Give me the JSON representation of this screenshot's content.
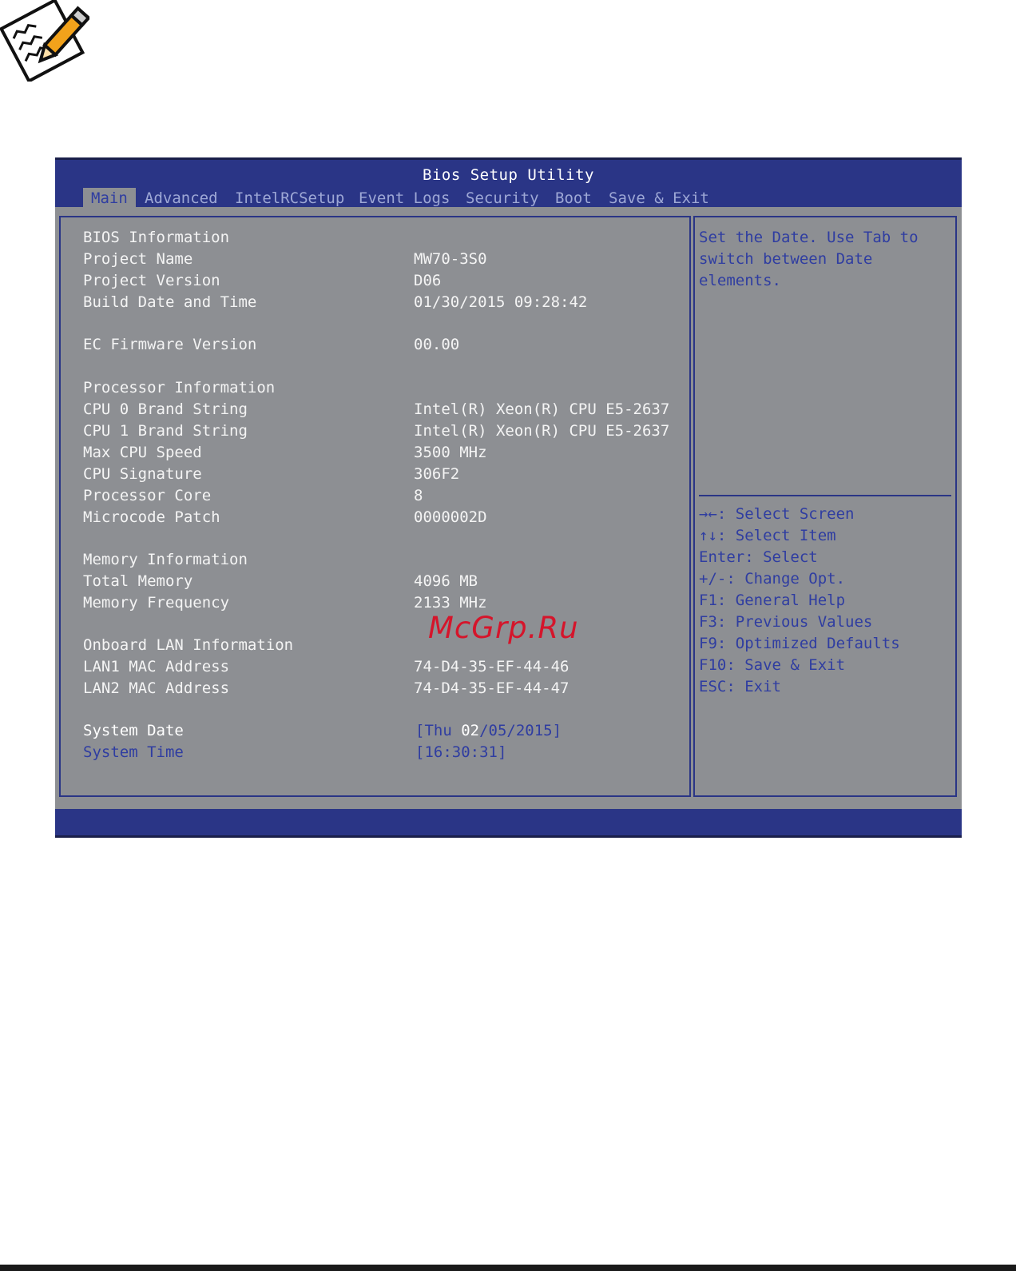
{
  "window": {
    "title": "Bios Setup Utility"
  },
  "tabs": [
    {
      "label": "Main",
      "active": true
    },
    {
      "label": "Advanced"
    },
    {
      "label": "IntelRCSetup"
    },
    {
      "label": "Event Logs"
    },
    {
      "label": "Security"
    },
    {
      "label": "Boot"
    },
    {
      "label": "Save & Exit"
    }
  ],
  "main": {
    "bios_info": "BIOS Information",
    "project_name": {
      "label": "Project Name",
      "value": "MW70-3S0"
    },
    "project_version": {
      "label": "Project Version",
      "value": "D06"
    },
    "build_date": {
      "label": "Build Date and Time",
      "value": "01/30/2015 09:28:42"
    },
    "ec_fw": {
      "label": "EC Firmware Version",
      "value": "00.00"
    },
    "proc_info": "Processor Information",
    "cpu0": {
      "label": "CPU 0 Brand String",
      "value": "Intel(R) Xeon(R) CPU E5-2637"
    },
    "cpu1": {
      "label": "CPU 1 Brand String",
      "value": "Intel(R) Xeon(R) CPU E5-2637"
    },
    "max_speed": {
      "label": "Max CPU Speed",
      "value": "3500 MHz"
    },
    "signature": {
      "label": "CPU Signature",
      "value": "306F2"
    },
    "core": {
      "label": "Processor Core",
      "value": "8"
    },
    "microcode": {
      "label": "Microcode Patch",
      "value": "0000002D"
    },
    "mem_info": "Memory Information",
    "total_mem": {
      "label": "Total Memory",
      "value": "4096 MB"
    },
    "mem_freq": {
      "label": "Memory Frequency",
      "value": "2133 MHz"
    },
    "lan_info": "Onboard LAN Information",
    "lan1": {
      "label": "LAN1 MAC Address",
      "value": "74-D4-35-EF-44-46"
    },
    "lan2": {
      "label": "LAN2 MAC Address",
      "value": "74-D4-35-EF-44-47"
    },
    "sys_date": {
      "label": "System Date",
      "open": "[Thu ",
      "month": "02",
      "rest": "/05/2015]"
    },
    "sys_time": {
      "label": "System Time",
      "value": "[16:30:31]"
    }
  },
  "help": {
    "description": [
      "Set the Date. Use Tab to",
      "switch between Date",
      "elements."
    ],
    "keys": [
      "→←: Select Screen",
      "↑↓: Select Item",
      "Enter: Select",
      "+/-: Change Opt.",
      "F1: General Help",
      "F3: Previous Values",
      "F9: Optimized Defaults",
      "F10: Save & Exit",
      "ESC: Exit"
    ]
  },
  "watermark": "McGrp.Ru",
  "icon": "note-pencil-icon"
}
